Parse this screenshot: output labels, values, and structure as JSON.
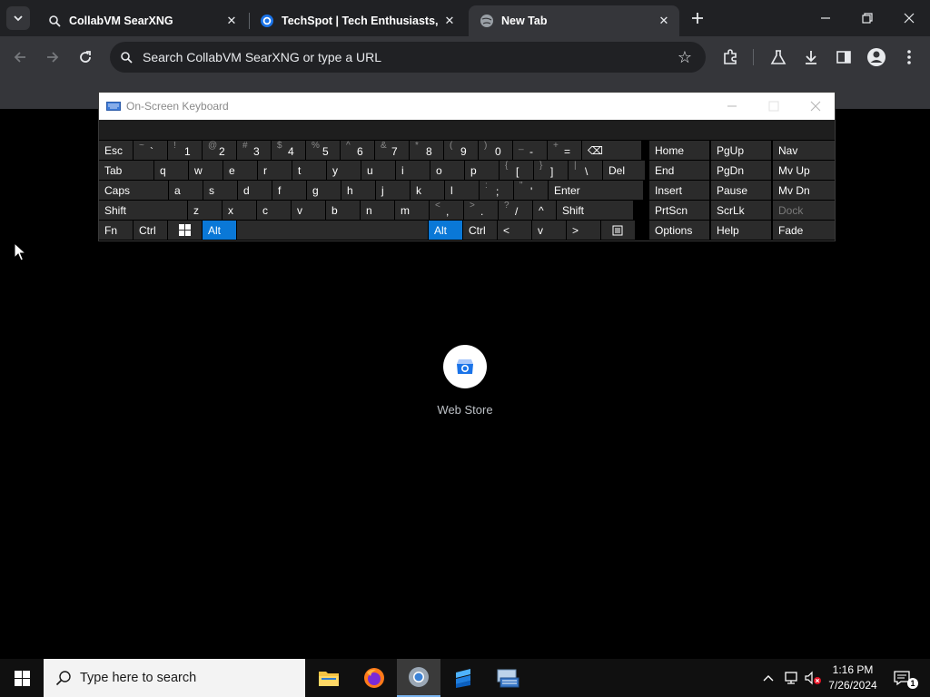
{
  "browser": {
    "tabs": [
      {
        "title": "CollabVM SearXNG",
        "icon": "searxng-icon",
        "active": false
      },
      {
        "title": "TechSpot | Tech Enthusiasts, Po",
        "icon": "techspot-icon",
        "active": false
      },
      {
        "title": "New Tab",
        "icon": "globe-icon",
        "active": true
      }
    ],
    "omnibox_placeholder": "Search CollabVM SearXNG or type a URL"
  },
  "new_tab": {
    "shortcuts": [
      {
        "label": "Web Store",
        "icon": "web-store-icon"
      }
    ]
  },
  "osk": {
    "title": "On-Screen Keyboard",
    "rows": [
      [
        {
          "label": "Esc"
        },
        {
          "shift": "~",
          "main": "`"
        },
        {
          "shift": "!",
          "main": "1"
        },
        {
          "shift": "@",
          "main": "2"
        },
        {
          "shift": "#",
          "main": "3"
        },
        {
          "shift": "$",
          "main": "4"
        },
        {
          "shift": "%",
          "main": "5"
        },
        {
          "shift": "^",
          "main": "6"
        },
        {
          "shift": "&",
          "main": "7"
        },
        {
          "shift": "*",
          "main": "8"
        },
        {
          "shift": "(",
          "main": "9"
        },
        {
          "shift": ")",
          "main": "0"
        },
        {
          "shift": "_",
          "main": "-"
        },
        {
          "shift": "+",
          "main": "="
        },
        {
          "label": "⌫"
        }
      ],
      [
        {
          "label": "Tab"
        },
        {
          "label": "q"
        },
        {
          "label": "w"
        },
        {
          "label": "e"
        },
        {
          "label": "r"
        },
        {
          "label": "t"
        },
        {
          "label": "y"
        },
        {
          "label": "u"
        },
        {
          "label": "i"
        },
        {
          "label": "o"
        },
        {
          "label": "p"
        },
        {
          "shift": "{",
          "main": "["
        },
        {
          "shift": "}",
          "main": "]"
        },
        {
          "shift": "|",
          "main": "\\"
        },
        {
          "label": "Del"
        }
      ],
      [
        {
          "label": "Caps"
        },
        {
          "label": "a"
        },
        {
          "label": "s"
        },
        {
          "label": "d"
        },
        {
          "label": "f"
        },
        {
          "label": "g"
        },
        {
          "label": "h"
        },
        {
          "label": "j"
        },
        {
          "label": "k"
        },
        {
          "label": "l"
        },
        {
          "shift": ":",
          "main": ";"
        },
        {
          "shift": "\"",
          "main": "'"
        },
        {
          "label": "Enter"
        }
      ],
      [
        {
          "label": "Shift"
        },
        {
          "label": "z"
        },
        {
          "label": "x"
        },
        {
          "label": "c"
        },
        {
          "label": "v"
        },
        {
          "label": "b"
        },
        {
          "label": "n"
        },
        {
          "label": "m"
        },
        {
          "shift": "<",
          "main": ","
        },
        {
          "shift": ">",
          "main": "."
        },
        {
          "shift": "?",
          "main": "/"
        },
        {
          "label": "^"
        },
        {
          "label": "Shift"
        }
      ],
      [
        {
          "label": "Fn"
        },
        {
          "label": "Ctrl"
        },
        {
          "label": "win-logo-icon"
        },
        {
          "label": "Alt",
          "state": "active"
        },
        {
          "label": ""
        },
        {
          "label": "Alt",
          "state": "active"
        },
        {
          "label": "Ctrl"
        },
        {
          "label": "<"
        },
        {
          "label": "v"
        },
        {
          "label": ">"
        },
        {
          "label": "menu-icon"
        }
      ]
    ],
    "nav_columns": [
      [
        "Home",
        "End",
        "Insert",
        "PrtScn",
        "Options"
      ],
      [
        "PgUp",
        "PgDn",
        "Pause",
        "ScrLk",
        "Help"
      ],
      [
        "Nav",
        "Mv Up",
        "Mv Dn",
        "Dock",
        "Fade"
      ]
    ],
    "dimmed_keys": [
      "Dock"
    ]
  },
  "taskbar": {
    "search_placeholder": "Type here to search",
    "apps": [
      "file-explorer-icon",
      "firefox-icon",
      "chrome-icon",
      "app-icon",
      "osk-app-icon"
    ],
    "active_app": "chrome-icon",
    "clock": {
      "time": "1:16 PM",
      "date": "7/26/2024"
    },
    "notifications_count": "1"
  },
  "colors": {
    "accent_blue": "#0a78d7",
    "tab_bar": "#202124",
    "toolbar": "#35363a"
  }
}
